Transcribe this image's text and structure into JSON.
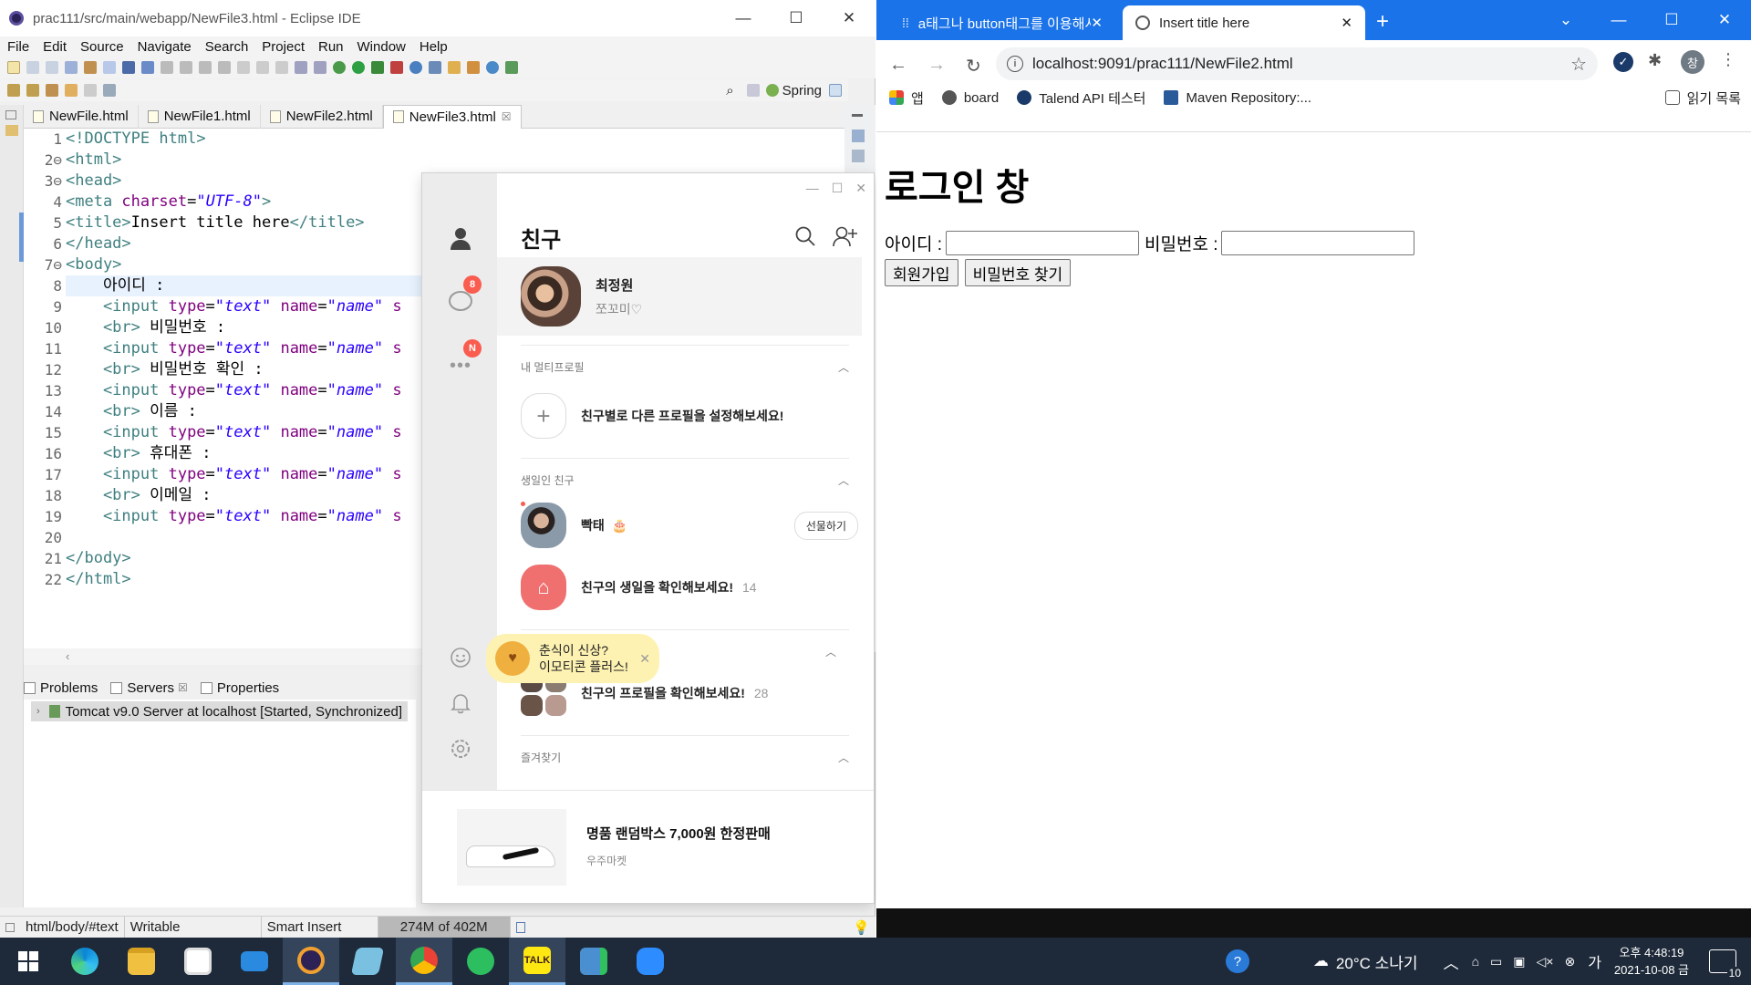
{
  "eclipse": {
    "window_title": "prac111/src/main/webapp/NewFile3.html - Eclipse IDE",
    "menu": [
      "File",
      "Edit",
      "Source",
      "Navigate",
      "Search",
      "Project",
      "Run",
      "Window",
      "Help"
    ],
    "perspective": "Spring",
    "editor_tabs": [
      "NewFile.html",
      "NewFile1.html",
      "NewFile2.html",
      "NewFile3.html"
    ],
    "active_tab_close": "☒",
    "code_lines": [
      {
        "n": "1",
        "segs": [
          {
            "t": "<!DOCTYPE ",
            "c": "tag"
          },
          {
            "t": "html",
            "c": "dt"
          },
          {
            "t": ">",
            "c": "tag"
          }
        ]
      },
      {
        "n": "2⊖",
        "segs": [
          {
            "t": "<html>",
            "c": "tag"
          }
        ]
      },
      {
        "n": "3⊖",
        "segs": [
          {
            "t": "<head>",
            "c": "tag"
          }
        ]
      },
      {
        "n": "4",
        "segs": [
          {
            "t": "<meta ",
            "c": "tag"
          },
          {
            "t": "charset",
            "c": "attr"
          },
          {
            "t": "=",
            "c": ""
          },
          {
            "t": "\"UTF-8\"",
            "c": "str"
          },
          {
            "t": ">",
            "c": "tag"
          }
        ]
      },
      {
        "n": "5",
        "segs": [
          {
            "t": "<title>",
            "c": "tag"
          },
          {
            "t": "Insert title here",
            "c": ""
          },
          {
            "t": "</title>",
            "c": "tag"
          }
        ]
      },
      {
        "n": "6",
        "segs": [
          {
            "t": "</head>",
            "c": "tag"
          }
        ]
      },
      {
        "n": "7⊖",
        "segs": [
          {
            "t": "<body>",
            "c": "tag"
          }
        ]
      },
      {
        "n": "8",
        "segs": [
          {
            "t": "    아이디 :",
            "c": ""
          }
        ],
        "hl": true
      },
      {
        "n": "9",
        "segs": [
          {
            "t": "    <input ",
            "c": "tag"
          },
          {
            "t": "type",
            "c": "attr"
          },
          {
            "t": "=",
            "c": ""
          },
          {
            "t": "\"text\"",
            "c": "str"
          },
          {
            "t": " name",
            "c": "attr"
          },
          {
            "t": "=",
            "c": ""
          },
          {
            "t": "\"name\"",
            "c": "str"
          },
          {
            "t": " s",
            "c": "attr"
          }
        ]
      },
      {
        "n": "10",
        "segs": [
          {
            "t": "    <br>",
            "c": "tag"
          },
          {
            "t": " 비밀번호 :",
            "c": ""
          }
        ]
      },
      {
        "n": "11",
        "segs": [
          {
            "t": "    <input ",
            "c": "tag"
          },
          {
            "t": "type",
            "c": "attr"
          },
          {
            "t": "=",
            "c": ""
          },
          {
            "t": "\"text\"",
            "c": "str"
          },
          {
            "t": " name",
            "c": "attr"
          },
          {
            "t": "=",
            "c": ""
          },
          {
            "t": "\"name\"",
            "c": "str"
          },
          {
            "t": " s",
            "c": "attr"
          }
        ]
      },
      {
        "n": "12",
        "segs": [
          {
            "t": "    <br>",
            "c": "tag"
          },
          {
            "t": " 비밀번호 확인 :",
            "c": ""
          }
        ]
      },
      {
        "n": "13",
        "segs": [
          {
            "t": "    <input ",
            "c": "tag"
          },
          {
            "t": "type",
            "c": "attr"
          },
          {
            "t": "=",
            "c": ""
          },
          {
            "t": "\"text\"",
            "c": "str"
          },
          {
            "t": " name",
            "c": "attr"
          },
          {
            "t": "=",
            "c": ""
          },
          {
            "t": "\"name\"",
            "c": "str"
          },
          {
            "t": " s",
            "c": "attr"
          }
        ]
      },
      {
        "n": "14",
        "segs": [
          {
            "t": "    <br>",
            "c": "tag"
          },
          {
            "t": " 이름 :",
            "c": ""
          }
        ]
      },
      {
        "n": "15",
        "segs": [
          {
            "t": "    <input ",
            "c": "tag"
          },
          {
            "t": "type",
            "c": "attr"
          },
          {
            "t": "=",
            "c": ""
          },
          {
            "t": "\"text\"",
            "c": "str"
          },
          {
            "t": " name",
            "c": "attr"
          },
          {
            "t": "=",
            "c": ""
          },
          {
            "t": "\"name\"",
            "c": "str"
          },
          {
            "t": " s",
            "c": "attr"
          }
        ]
      },
      {
        "n": "16",
        "segs": [
          {
            "t": "    <br>",
            "c": "tag"
          },
          {
            "t": " 휴대폰 :",
            "c": ""
          }
        ]
      },
      {
        "n": "17",
        "segs": [
          {
            "t": "    <input ",
            "c": "tag"
          },
          {
            "t": "type",
            "c": "attr"
          },
          {
            "t": "=",
            "c": ""
          },
          {
            "t": "\"text\"",
            "c": "str"
          },
          {
            "t": " name",
            "c": "attr"
          },
          {
            "t": "=",
            "c": ""
          },
          {
            "t": "\"name\"",
            "c": "str"
          },
          {
            "t": " s",
            "c": "attr"
          }
        ]
      },
      {
        "n": "18",
        "segs": [
          {
            "t": "    <br>",
            "c": "tag"
          },
          {
            "t": " 이메일 :",
            "c": ""
          }
        ]
      },
      {
        "n": "19",
        "segs": [
          {
            "t": "    <input ",
            "c": "tag"
          },
          {
            "t": "type",
            "c": "attr"
          },
          {
            "t": "=",
            "c": ""
          },
          {
            "t": "\"text\"",
            "c": "str"
          },
          {
            "t": " name",
            "c": "attr"
          },
          {
            "t": "=",
            "c": ""
          },
          {
            "t": "\"name\"",
            "c": "str"
          },
          {
            "t": " s",
            "c": "attr"
          }
        ]
      },
      {
        "n": "20",
        "segs": []
      },
      {
        "n": "21",
        "segs": [
          {
            "t": "</body>",
            "c": "tag"
          }
        ]
      },
      {
        "n": "22",
        "segs": [
          {
            "t": "</html>",
            "c": "tag"
          }
        ]
      }
    ],
    "bottom_tabs": [
      "Problems",
      "Servers",
      "Properties"
    ],
    "servers_tab_close": "☒",
    "server_row": "Tomcat v9.0 Server at localhost  [Started, Synchronized]",
    "status": {
      "path": "html/body/#text",
      "mode": "Writable",
      "insert": "Smart Insert",
      "heap": "274M of 402M"
    }
  },
  "kakao": {
    "header": "친구",
    "badges": {
      "chat": "8",
      "more": "N"
    },
    "me": {
      "name": "최정원",
      "status": "쪼꼬미♡"
    },
    "multi_section": "내 멀티프로필",
    "multi_cta": "친구별로 다른 프로필을 설정해보세요!",
    "bday_section": "생일인 친구",
    "bday_friend": "빡태",
    "gift_button": "선물하기",
    "bday_check": "친구의 생일을 확인해보세요!",
    "bday_count": "14",
    "profile_check": "친구의 프로필을 확인해보세요!",
    "profile_count": "28",
    "fav_section": "즐겨찾기",
    "emoticon_tip_1": "춘식이 신상?",
    "emoticon_tip_2": "이모티콘 플러스!",
    "ad_title": "명품 랜덤박스 7,000원 한정판매",
    "ad_source": "우주마켓"
  },
  "chrome": {
    "tabs": [
      {
        "title": "a태그나 button태그를 이용해서",
        "active": false
      },
      {
        "title": "Insert title here",
        "active": true
      }
    ],
    "url": "localhost:9091/prac111/NewFile2.html",
    "profile_initial": "창",
    "bookmarks": [
      "앱",
      "board",
      "Talend API 테스터",
      "Maven Repository:..."
    ],
    "reading_list": "읽기 목록",
    "page": {
      "heading": "로그인 창",
      "id_label": "아이디 :",
      "pw_label": "비밀번호 :",
      "signup_button": "회원가입",
      "findpw_button": "비밀번호 찾기"
    }
  },
  "taskbar": {
    "weather": "20°C  소나기",
    "ime": "가",
    "time": "오후 4:48:19",
    "date": "2021-10-08 금",
    "notifications": "10"
  }
}
